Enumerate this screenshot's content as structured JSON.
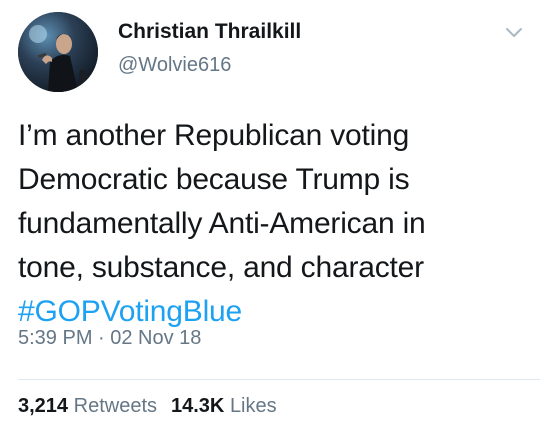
{
  "author": {
    "display_name": "Christian Thrailkill",
    "handle": "@Wolvie616"
  },
  "icons": {
    "avatar": "profile-photo",
    "menu": "chevron-down-icon"
  },
  "tweet": {
    "lines": [
      "I’m another Republican voting",
      "Democratic because Trump is",
      "fundamentally Anti-American in",
      "tone, substance, and character"
    ],
    "hashtag": "#GOPVotingBlue"
  },
  "timestamp": "5:39 PM · 02 Nov 18",
  "stats": {
    "retweets_count": "3,214",
    "retweets_label": "Retweets",
    "likes_count": "14.3K",
    "likes_label": "Likes"
  },
  "colors": {
    "link": "#1da1f2",
    "secondary_text": "#657786",
    "primary_text": "#14171a",
    "divider": "#e1e8ed"
  }
}
